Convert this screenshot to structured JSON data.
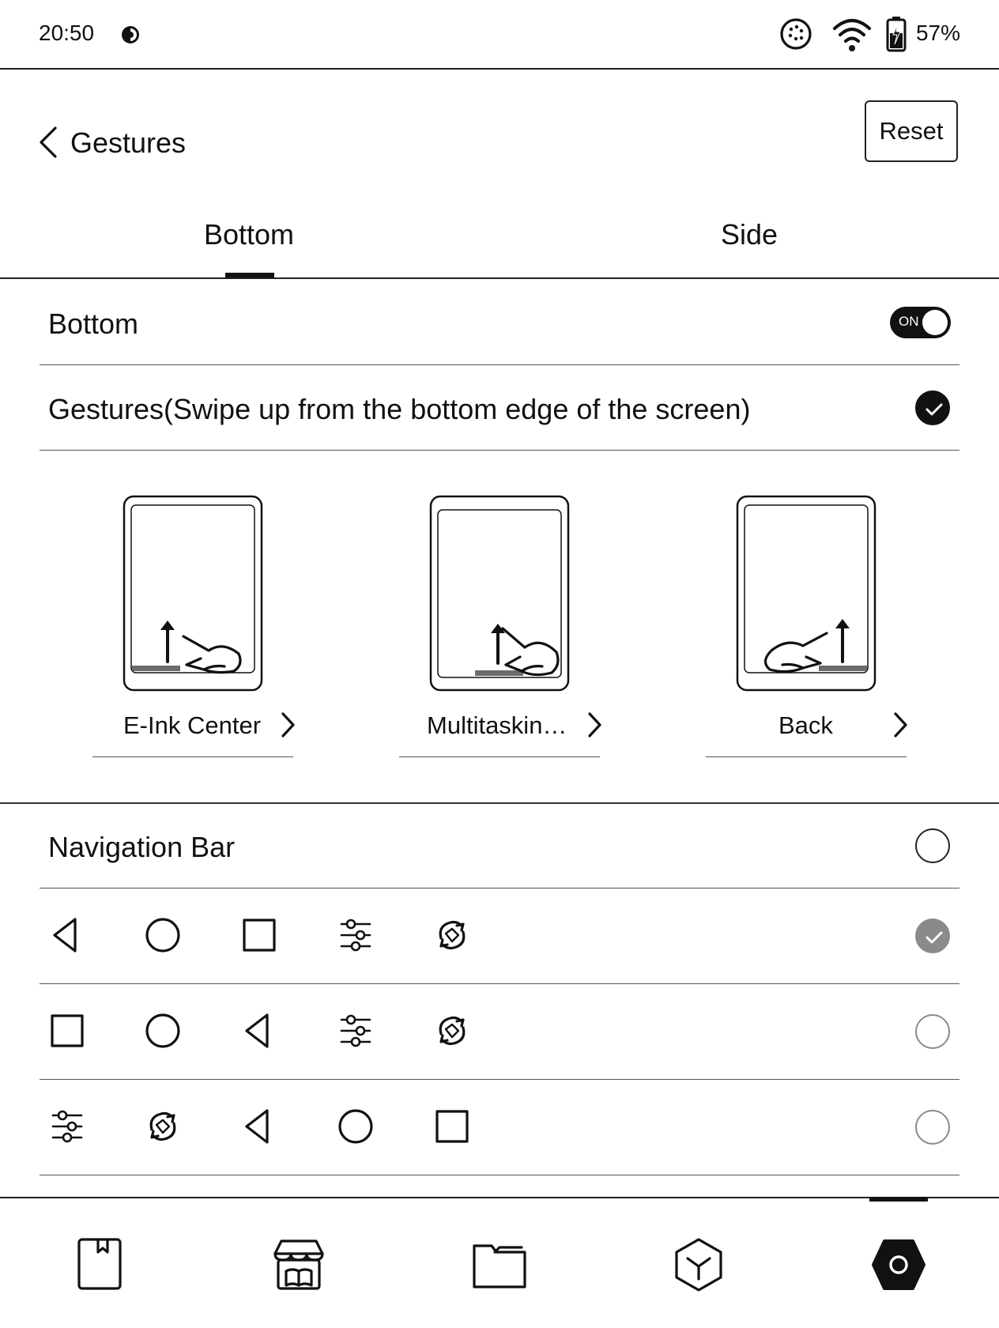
{
  "status_bar": {
    "time": "20:50",
    "battery_percent": "57%",
    "icons": [
      "theme-contrast-icon",
      "refresh-dots-icon",
      "wifi-icon",
      "battery-charging-icon"
    ]
  },
  "header": {
    "title": "Gestures",
    "reset_label": "Reset"
  },
  "tabs": [
    {
      "label": "Bottom",
      "active": true
    },
    {
      "label": "Side",
      "active": false
    }
  ],
  "bottom_section": {
    "label": "Bottom",
    "toggle_text": "ON",
    "toggle_on": true
  },
  "gestures_option": {
    "label": "Gestures(Swipe up from the bottom edge of the screen)",
    "selected": true
  },
  "gesture_actions": [
    {
      "label": "E-Ink Center",
      "zone": "left"
    },
    {
      "label": "Multitaskin…",
      "zone": "center"
    },
    {
      "label": "Back",
      "zone": "right"
    }
  ],
  "navigation_bar": {
    "label": "Navigation Bar",
    "selected": false,
    "layouts": [
      {
        "icons": [
          "back-triangle-icon",
          "home-circle-icon",
          "recents-square-icon",
          "sliders-icon",
          "refresh-icon"
        ],
        "selected": true
      },
      {
        "icons": [
          "recents-square-icon",
          "home-circle-icon",
          "back-triangle-icon",
          "sliders-icon",
          "refresh-icon"
        ],
        "selected": false
      },
      {
        "icons": [
          "sliders-icon",
          "refresh-icon",
          "back-triangle-icon",
          "home-circle-icon",
          "recents-square-icon"
        ],
        "selected": false
      }
    ]
  },
  "bottom_nav": {
    "items": [
      "library-icon",
      "store-icon",
      "folder-icon",
      "apps-cube-icon",
      "settings-hexagon-icon"
    ],
    "active_index": 4
  },
  "colors": {
    "ink": "#111111",
    "muted_gray": "#8a8a8a",
    "accent_bar": "#6b6b6b"
  }
}
